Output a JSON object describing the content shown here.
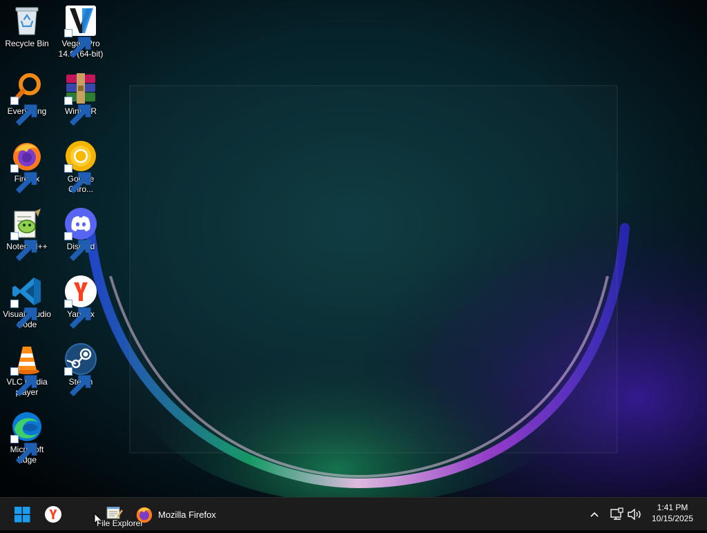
{
  "desktop": {
    "icons": [
      {
        "id": "recycle-bin",
        "label": "Recycle Bin"
      },
      {
        "id": "vegas-pro",
        "label": "Vegas Pro 14.0 (64-bit)"
      },
      {
        "id": "everything",
        "label": "Everything"
      },
      {
        "id": "winrar",
        "label": "WinRAR"
      },
      {
        "id": "firefox",
        "label": "Firefox"
      },
      {
        "id": "google-chrome",
        "label": "Google Chro..."
      },
      {
        "id": "notepad-plus-plus",
        "label": "Notepad++"
      },
      {
        "id": "discord",
        "label": "Discord"
      },
      {
        "id": "visual-studio-code",
        "label": "Visual Studio Code"
      },
      {
        "id": "yandex",
        "label": "Yandex"
      },
      {
        "id": "vlc",
        "label": "VLC media player"
      },
      {
        "id": "steam",
        "label": "Steam"
      },
      {
        "id": "microsoft-edge",
        "label": "Microsoft Edge"
      }
    ]
  },
  "taskbar": {
    "start_icon": "windows-logo-icon",
    "drag_label": "File Explorer",
    "firefox_window_title": "Mozilla Firefox",
    "tray": {
      "time": "1:41 PM",
      "date": "10/15/2025"
    }
  },
  "colors": {
    "taskbar_bg": "#1c1c1c",
    "accent_blue": "#0078d4"
  }
}
